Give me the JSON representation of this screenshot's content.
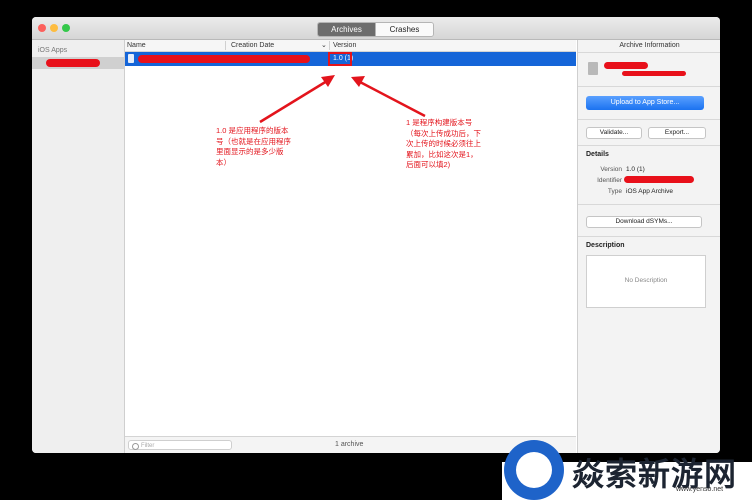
{
  "window": {
    "tabs": [
      {
        "label": "Archives",
        "active": true
      },
      {
        "label": "Crashes",
        "active": false
      }
    ]
  },
  "sidebar": {
    "header": "iOS Apps"
  },
  "table": {
    "columns": [
      "Name",
      "Creation Date",
      "Version"
    ],
    "rows": [
      {
        "version": "1.0 (1)"
      }
    ],
    "filter_placeholder": "Filter",
    "count_label": "1 archive"
  },
  "annotations": {
    "left_note": [
      "1.0 是应用程序的版本",
      "号（也就是在应用程序",
      "里面显示的是多少版",
      "本）"
    ],
    "right_note": [
      "1 是程序构建版本号",
      "（每次上传成功后，下",
      "次上传的时候必须往上",
      "累加，比如这次是1，",
      "后面可以填2)"
    ]
  },
  "inspector": {
    "title": "Archive Information",
    "upload_label": "Upload to App Store...",
    "validate_label": "Validate...",
    "export_label": "Export...",
    "details_heading": "Details",
    "details": {
      "version_key": "Version",
      "version_value": "1.0 (1)",
      "identifier_key": "Identifier",
      "type_key": "Type",
      "type_value": "iOS App Archive"
    },
    "download_label": "Download dSYMs...",
    "description_heading": "Description",
    "description_placeholder": "No Description"
  },
  "watermark": {
    "brand": "焱索新游网",
    "url": "www.yenso.net"
  },
  "colors": {
    "accent": "#1565d8",
    "annotation": "#e3141c"
  }
}
